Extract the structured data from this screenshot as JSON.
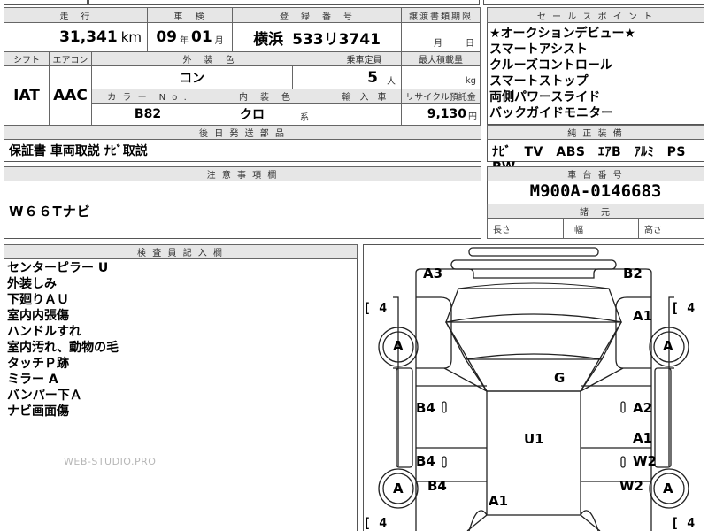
{
  "top": {
    "col1": "走　行",
    "col2": "車　検",
    "col3": "登　録　番　号",
    "col4": "譲渡書類期限",
    "mileage": "31,341",
    "mileage_unit": "km",
    "shaken_year": "09",
    "shaken_year_unit": "年",
    "shaken_month": "01",
    "shaken_month_unit": "月",
    "reg_city": "横浜",
    "reg_number": "533リ3741",
    "deadline_month": "月",
    "deadline_day": "日"
  },
  "sales_points": {
    "header": "セ ー ル ス ポ イ ン ト",
    "items": [
      "★オークションデビュー★",
      "スマートアシスト",
      "クルーズコントロール",
      "スマートストップ",
      "両側パワースライド",
      "バックガイドモニター"
    ]
  },
  "spec": {
    "shift_label": "シフト",
    "ac_label": "エアコン",
    "exterior_label": "外　装　色",
    "seats_label": "乗車定員",
    "capacity_label": "最大積載量",
    "shift": "IAT",
    "ac": "AAC",
    "exterior": "コン",
    "seats": "5",
    "seats_unit": "人",
    "capacity_unit": "kg",
    "color_no_label": "カ ラ ー　N o .",
    "interior_label": "内　装　色",
    "import_label": "輸　入　車",
    "recycle_label": "リサイクル預託金",
    "color_no": "B82",
    "interior": "クロ",
    "interior_unit": "系",
    "recycle": "9,130",
    "recycle_unit": "円"
  },
  "parts": {
    "header": "後 日 発 送 部 品",
    "value": "保証書 車両取説 ﾅﾋﾞ取説"
  },
  "equipment": {
    "header": "純 正 装 備",
    "value": "ﾅﾋﾞ　TV　ABS　ｴｱB　ｱﾙﾐ　PS　PW"
  },
  "notes": {
    "header": "注 意 事 項 欄",
    "value": "W６６Tナビ"
  },
  "chassis": {
    "header": "車 台 番 号",
    "value": "M900A-0146683"
  },
  "dims": {
    "header": "諸　元",
    "length": "長さ",
    "width": "幅",
    "height": "高さ"
  },
  "inspector": {
    "header": "検 査 員 記 入 欄",
    "items": [
      "センターピラー U",
      "外装しみ",
      "下廻りＡＵ",
      "室内内張傷",
      "ハンドルすれ",
      "室内汚れ、動物の毛",
      "タッチＰ跡",
      "ミラー A",
      "バンパー下Ａ",
      "ナビ画面傷"
    ]
  },
  "watermark": "WEB-STUDIO.PRO",
  "diagram": {
    "tl": "A3",
    "tr": "B2",
    "tire": "4",
    "wheel": "A",
    "roof": "G",
    "body": "U1",
    "left": [
      "B4",
      "B4",
      "B4"
    ],
    "right": [
      "A1",
      "A2",
      "A1",
      "W2",
      "W2"
    ],
    "bottom": "A1"
  }
}
